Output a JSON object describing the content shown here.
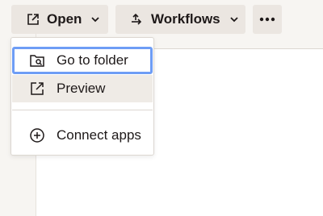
{
  "toolbar": {
    "open_label": "Open",
    "workflows_label": "Workflows",
    "open_icon": "open-external-icon",
    "workflows_icon": "workflows-icon",
    "more_icon": "more-horizontal-icon"
  },
  "menu": {
    "items": [
      {
        "label": "Go to folder",
        "icon": "folder-search-icon",
        "state": "focused"
      },
      {
        "label": "Preview",
        "icon": "open-external-icon",
        "state": "hovered"
      },
      {
        "label": "Connect apps",
        "icon": "plus-circle-icon",
        "state": "default"
      }
    ]
  },
  "colors": {
    "focus_ring": "#6e9df5",
    "button_bg": "#ebe6e1",
    "hover_bg": "#efebe6",
    "text": "#1e1919"
  }
}
